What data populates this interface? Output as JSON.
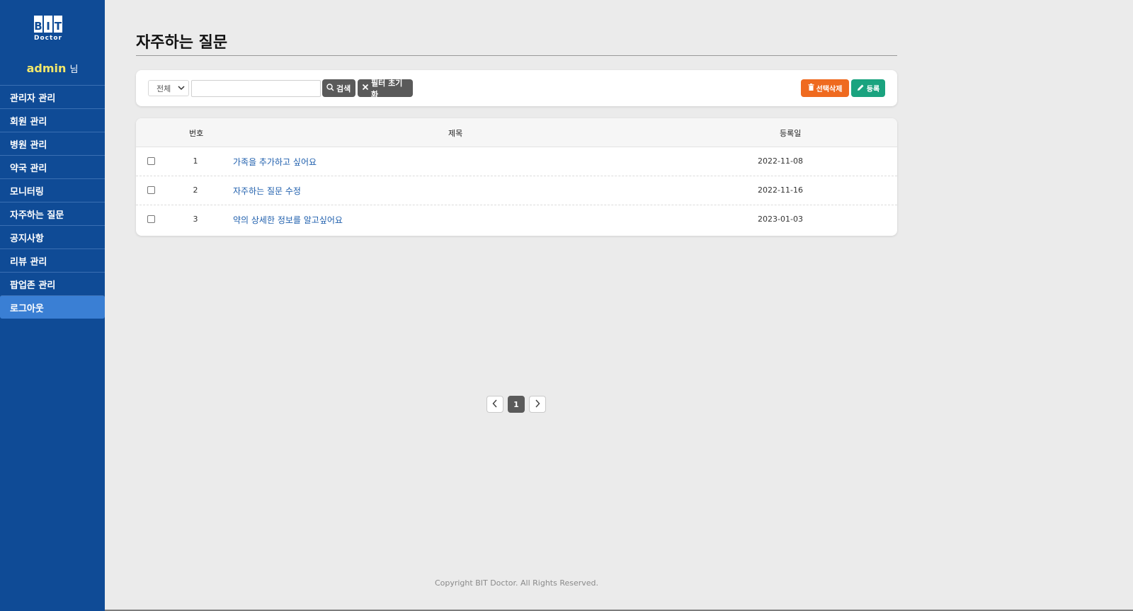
{
  "sidebar": {
    "logo": {
      "letters": [
        "B",
        "I",
        "T"
      ],
      "subtitle": "Doctor"
    },
    "user": {
      "name": "admin",
      "suffix": "님"
    },
    "menu": [
      {
        "label": "관리자 관리"
      },
      {
        "label": "회원 관리"
      },
      {
        "label": "병원 관리"
      },
      {
        "label": "약국 관리"
      },
      {
        "label": "모니터링"
      },
      {
        "label": "자주하는 질문"
      },
      {
        "label": "공지사항"
      },
      {
        "label": "리뷰 관리"
      },
      {
        "label": "팝업존 관리"
      },
      {
        "label": "로그아웃",
        "active": true
      }
    ],
    "colors": {
      "background": "#0f4b96",
      "active": "#3a7fd4",
      "username": "#f2e76a"
    }
  },
  "main": {
    "title": "자주하는 질문",
    "search": {
      "filter_selected": "전체",
      "input_value": "",
      "search_label": "검색",
      "reset_label": "필터 초기화",
      "delete_label": "선택삭제",
      "register_label": "등록"
    },
    "table": {
      "headers": {
        "number": "번호",
        "title": "제목",
        "date": "등록일"
      },
      "rows": [
        {
          "number": "1",
          "title": "가족을 추가하고 싶어요",
          "date": "2022-11-08"
        },
        {
          "number": "2",
          "title": "자주하는 질문 수정",
          "date": "2022-11-16"
        },
        {
          "number": "3",
          "title": "약의 상세한 정보를 알고싶어요",
          "date": "2023-01-03"
        }
      ]
    },
    "pagination": {
      "prev": "‹",
      "current": "1",
      "next": "›"
    },
    "footer": "Copyright BIT Doctor. All Rights Reserved.",
    "colors": {
      "delete_button": "#ef6a1f",
      "register_button": "#1aa37f",
      "link": "#1f5fad"
    }
  }
}
